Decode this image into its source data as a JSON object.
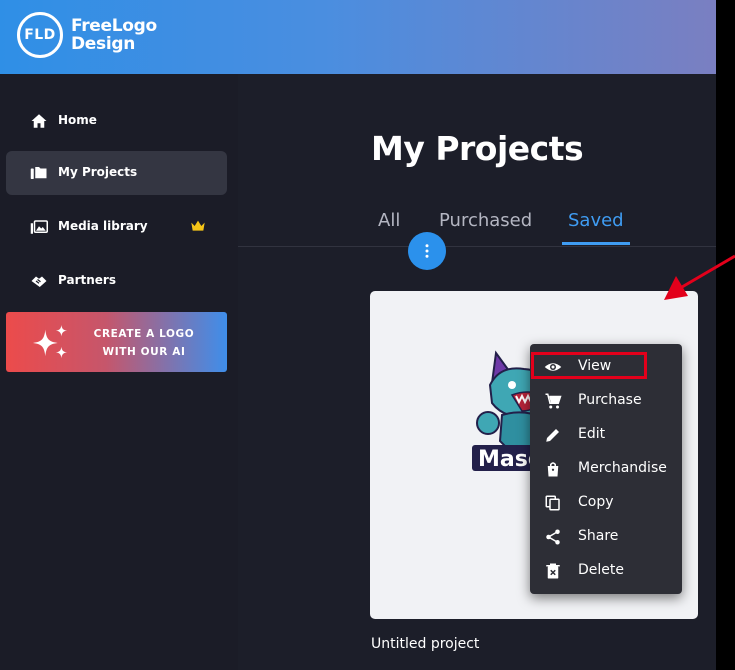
{
  "brand": {
    "logo_mark": "FLD",
    "name_line1": "FreeLogo",
    "name_line2": "Design"
  },
  "sidebar": {
    "items": [
      {
        "label": "Home",
        "icon": "home-icon",
        "active": false
      },
      {
        "label": "My Projects",
        "icon": "folder-icon",
        "active": true
      },
      {
        "label": "Media library",
        "icon": "image-library-icon",
        "active": false,
        "badge": "crown-icon"
      },
      {
        "label": "Partners",
        "icon": "handshake-icon",
        "active": false
      }
    ],
    "cta": {
      "line1": "CREATE A LOGO",
      "line2": "WITH OUR AI",
      "icon": "sparkle-icon"
    }
  },
  "main": {
    "title": "My Projects",
    "tabs": [
      {
        "label": "All",
        "active": false
      },
      {
        "label": "Purchased",
        "active": false
      },
      {
        "label": "Saved",
        "active": true
      }
    ],
    "project": {
      "name": "Untitled project",
      "thumbnail_text": "Masc"
    }
  },
  "menu": {
    "items": [
      {
        "label": "View",
        "icon": "eye-icon",
        "highlighted": true
      },
      {
        "label": "Purchase",
        "icon": "cart-icon"
      },
      {
        "label": "Edit",
        "icon": "pencil-icon"
      },
      {
        "label": "Merchandise",
        "icon": "shopping-bag-icon"
      },
      {
        "label": "Copy",
        "icon": "copy-icon"
      },
      {
        "label": "Share",
        "icon": "share-icon"
      },
      {
        "label": "Delete",
        "icon": "trash-icon"
      }
    ]
  },
  "colors": {
    "accent": "#3f9cf2",
    "sidebar_bg": "#1b1c27",
    "main_bg": "#1c1e29",
    "menu_bg": "#2d2e36",
    "highlight": "#e3001b"
  }
}
